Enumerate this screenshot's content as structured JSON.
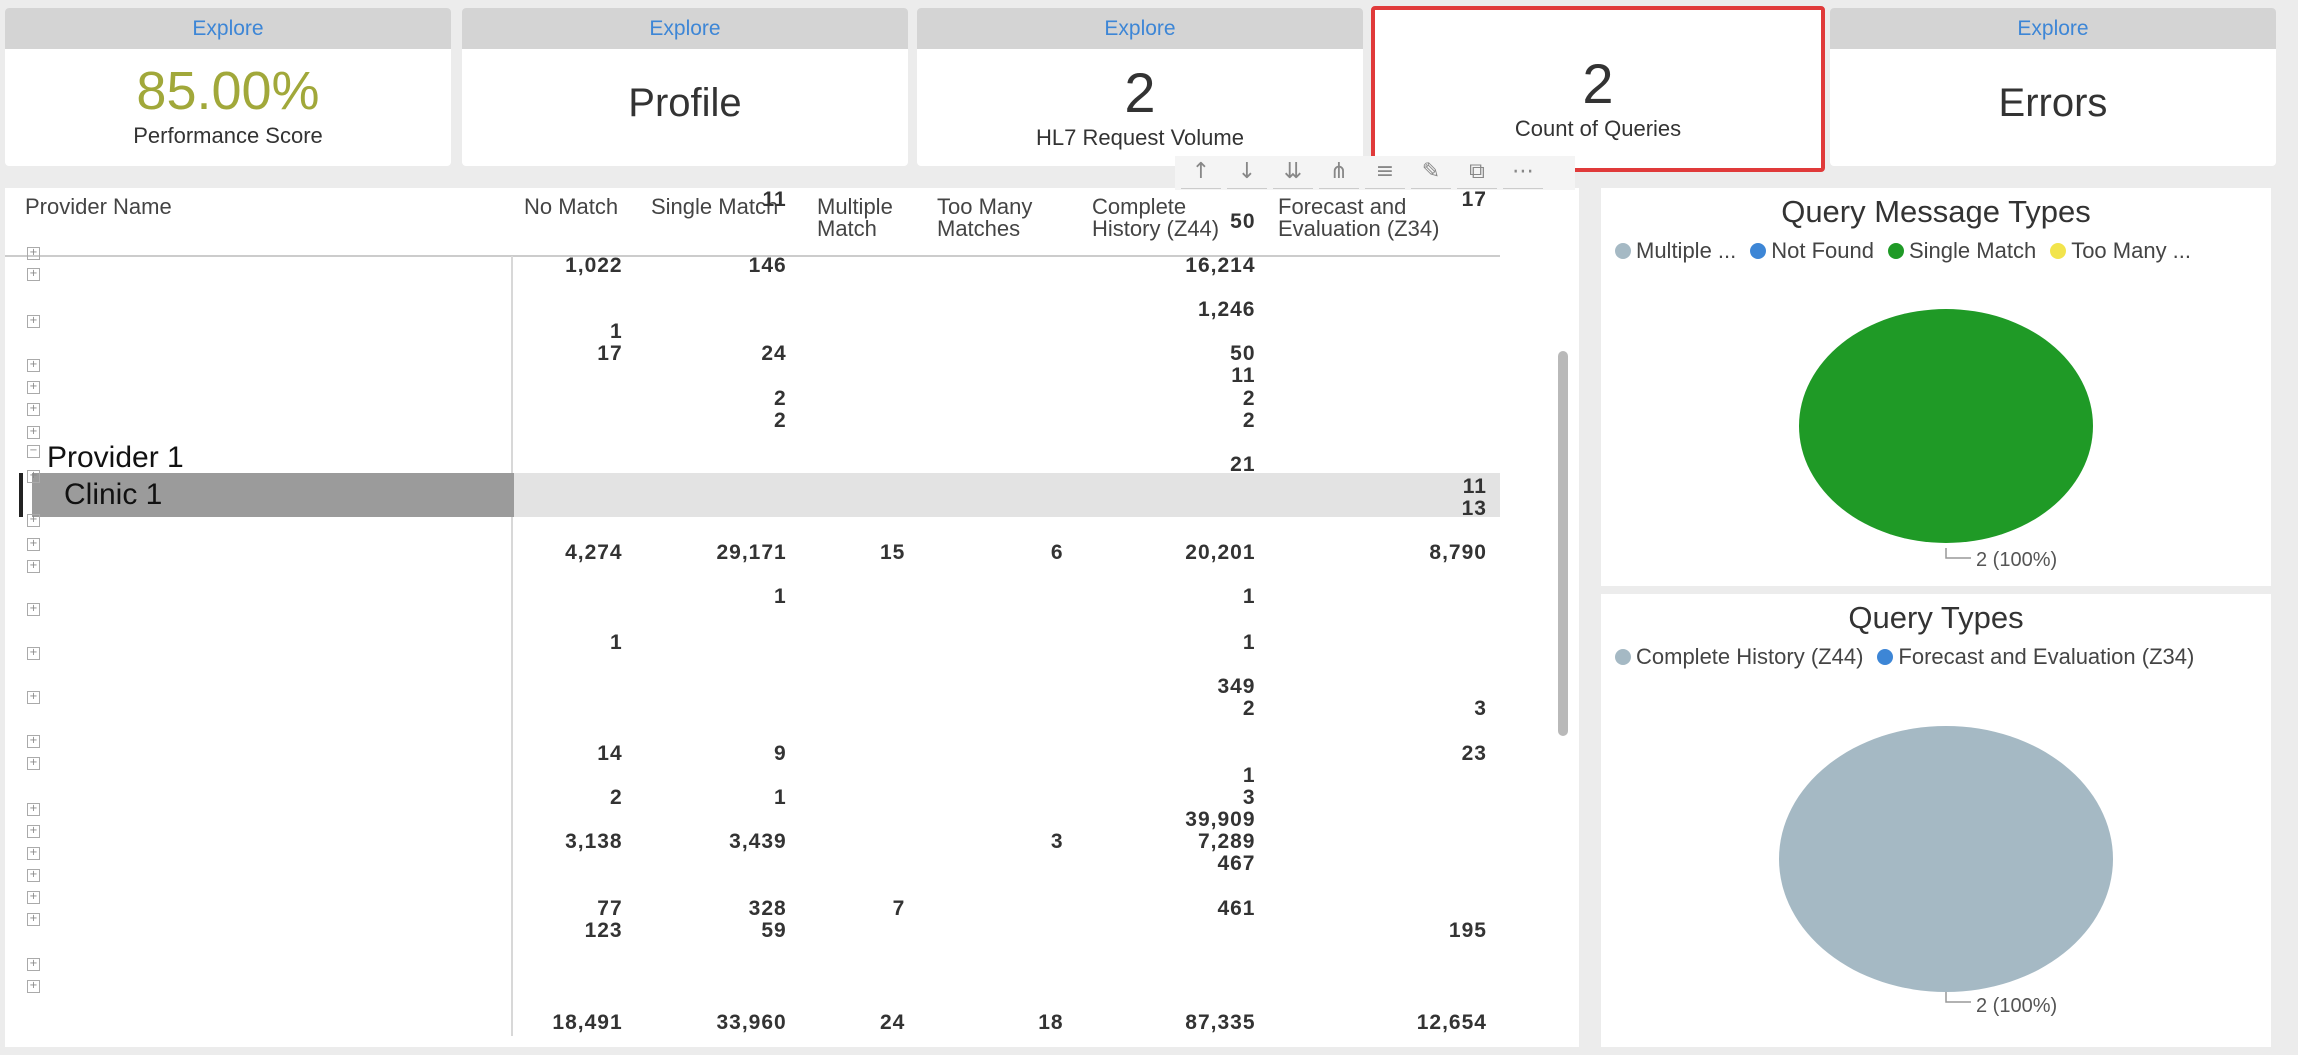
{
  "cards": [
    {
      "explore": "Explore",
      "value": "85.00%",
      "label": "Performance Score"
    },
    {
      "explore": "Explore",
      "value": "Profile",
      "label": ""
    },
    {
      "explore": "Explore",
      "value": "2",
      "label": "HL7 Request Volume"
    },
    {
      "explore": "",
      "value": "2",
      "label": "Count of Queries"
    },
    {
      "explore": "Explore",
      "value": "Errors",
      "label": ""
    }
  ],
  "table": {
    "headers": {
      "provider": "Provider Name",
      "no_match": "No Match",
      "single_match": "Single Match",
      "multiple_match_1": "Multiple",
      "multiple_match_2": "Match",
      "too_many_1": "Too Many",
      "too_many_2": "Matches",
      "z44_1": "Complete",
      "z44_2": "History (Z44)",
      "z34_1": "Forecast and",
      "z34_2": "Evaluation (Z34)"
    },
    "provider_label": "Provider 1",
    "clinic_label": "Clinic 1",
    "rows": [
      {
        "nm": "",
        "sm": "11",
        "mm": "",
        "tm": "",
        "z44": "",
        "z34": "17"
      },
      {
        "nm": "",
        "sm": "",
        "mm": "",
        "tm": "",
        "z44": "50",
        "z34": ""
      },
      {
        "nm": "1,022",
        "sm": "146",
        "mm": "",
        "tm": "",
        "z44": "16,214",
        "z34": ""
      },
      {
        "nm": "",
        "sm": "",
        "mm": "",
        "tm": "",
        "z44": "1,246",
        "z34": ""
      },
      {
        "nm": "1",
        "sm": "",
        "mm": "",
        "tm": "",
        "z44": "",
        "z34": ""
      },
      {
        "nm": "17",
        "sm": "24",
        "mm": "",
        "tm": "",
        "z44": "50",
        "z34": ""
      },
      {
        "nm": "",
        "sm": "",
        "mm": "",
        "tm": "",
        "z44": "11",
        "z34": ""
      },
      {
        "nm": "",
        "sm": "2",
        "mm": "",
        "tm": "",
        "z44": "2",
        "z34": ""
      },
      {
        "nm": "",
        "sm": "2",
        "mm": "",
        "tm": "",
        "z44": "2",
        "z34": ""
      },
      {
        "nm": "",
        "sm": "",
        "mm": "",
        "tm": "",
        "z44": "21",
        "z34": ""
      },
      {
        "nm": "",
        "sm": "",
        "mm": "",
        "tm": "",
        "z44": "",
        "z34": "11"
      },
      {
        "nm": "",
        "sm": "",
        "mm": "",
        "tm": "",
        "z44": "",
        "z34": "13"
      },
      {
        "nm": "4,274",
        "sm": "29,171",
        "mm": "15",
        "tm": "6",
        "z44": "20,201",
        "z34": "8,790"
      },
      {
        "nm": "",
        "sm": "1",
        "mm": "",
        "tm": "",
        "z44": "1",
        "z34": ""
      },
      {
        "nm": "1",
        "sm": "",
        "mm": "",
        "tm": "",
        "z44": "1",
        "z34": ""
      },
      {
        "nm": "",
        "sm": "",
        "mm": "",
        "tm": "",
        "z44": "349",
        "z34": ""
      },
      {
        "nm": "",
        "sm": "",
        "mm": "",
        "tm": "",
        "z44": "2",
        "z34": "3"
      },
      {
        "nm": "14",
        "sm": "9",
        "mm": "",
        "tm": "",
        "z44": "",
        "z34": "23"
      },
      {
        "nm": "",
        "sm": "",
        "mm": "",
        "tm": "",
        "z44": "1",
        "z34": ""
      },
      {
        "nm": "2",
        "sm": "1",
        "mm": "",
        "tm": "",
        "z44": "3",
        "z34": ""
      },
      {
        "nm": "",
        "sm": "",
        "mm": "",
        "tm": "",
        "z44": "39,909",
        "z34": ""
      },
      {
        "nm": "3,138",
        "sm": "3,439",
        "mm": "",
        "tm": "3",
        "z44": "7,289",
        "z34": ""
      },
      {
        "nm": "",
        "sm": "",
        "mm": "",
        "tm": "",
        "z44": "467",
        "z34": ""
      },
      {
        "nm": "77",
        "sm": "328",
        "mm": "7",
        "tm": "",
        "z44": "461",
        "z34": ""
      },
      {
        "nm": "123",
        "sm": "59",
        "mm": "",
        "tm": "",
        "z44": "",
        "z34": "195"
      }
    ],
    "totals": {
      "nm": "18,491",
      "sm": "33,960",
      "mm": "24",
      "tm": "18",
      "z44": "87,335",
      "z34": "12,654"
    }
  },
  "toolbar_icons": [
    "arrow-up-icon",
    "arrow-down-icon",
    "double-arrow-down-icon",
    "hierarchy-icon",
    "filter-icon",
    "focus-mode-icon",
    "export-icon",
    "more-options-icon"
  ],
  "message_types": {
    "title": "Query Message Types",
    "legend": [
      {
        "label": "Multiple ...",
        "color": "#a5b9c4"
      },
      {
        "label": "Not Found",
        "color": "#3d86d6"
      },
      {
        "label": "Single Match",
        "color": "#1f9a26"
      },
      {
        "label": "Too Many ...",
        "color": "#f2e44c"
      }
    ],
    "slice_label": "2 (100%)",
    "chart_data": {
      "type": "pie",
      "categories": [
        "Single Match"
      ],
      "values": [
        2
      ]
    }
  },
  "query_types": {
    "title": "Query Types",
    "legend": [
      {
        "label": "Complete History (Z44)",
        "color": "#a5b9c4"
      },
      {
        "label": "Forecast and Evaluation (Z34)",
        "color": "#3d86d6"
      }
    ],
    "slice_label": "2 (100%)",
    "chart_data": {
      "type": "pie",
      "categories": [
        "Complete History (Z44)"
      ],
      "values": [
        2
      ]
    }
  },
  "colors": {
    "accent": "#3d86d6",
    "score": "#a1a83a",
    "selected_border": "#e03a3a"
  }
}
